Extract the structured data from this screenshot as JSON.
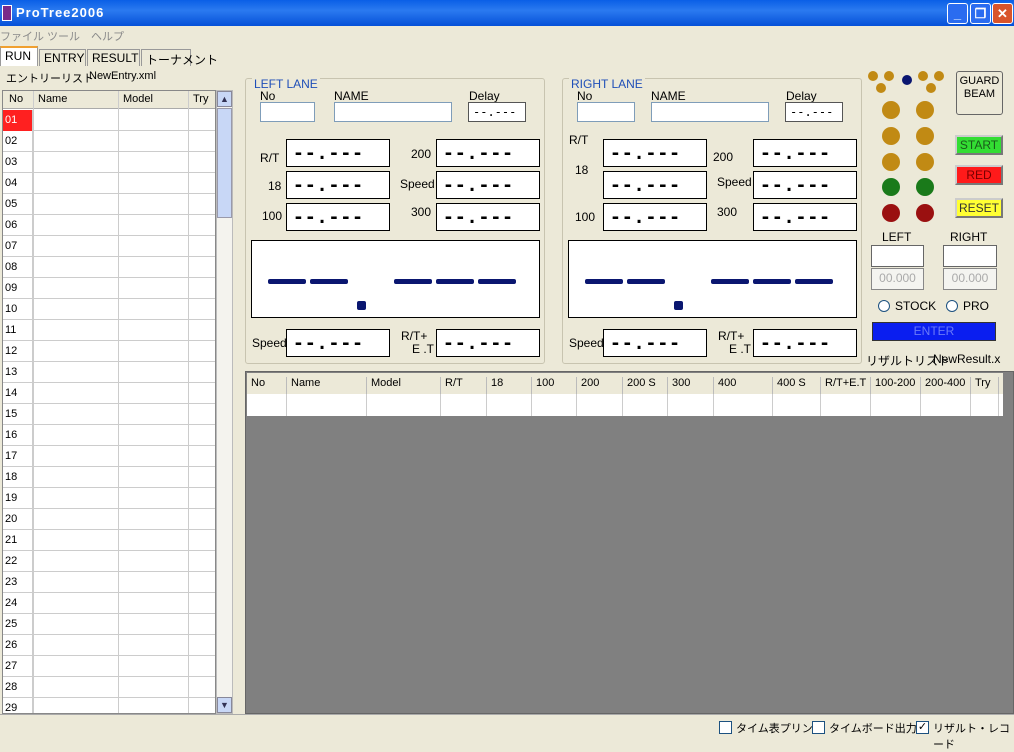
{
  "window": {
    "title": "ProTree2006"
  },
  "menu": [
    "ファイル",
    "ツール",
    "ヘルプ"
  ],
  "tabs": [
    "RUN",
    "ENTRY",
    "RESULT",
    "トーナメント"
  ],
  "entry": {
    "label": "エントリーリスト",
    "file": "NewEntry.xml",
    "headers": [
      "No",
      "Name",
      "Model",
      "Try"
    ],
    "rows": [
      "01",
      "02",
      "03",
      "04",
      "05",
      "06",
      "07",
      "08",
      "09",
      "10",
      "11",
      "12",
      "13",
      "14",
      "15",
      "16",
      "17",
      "18",
      "19",
      "20",
      "21",
      "22",
      "23",
      "24",
      "25",
      "26",
      "27",
      "28",
      "29"
    ]
  },
  "left_lane": {
    "legend": "LEFT LANE",
    "no_label": "No",
    "name_label": "NAME",
    "delay_label": "Delay",
    "delay_value": "--.---",
    "rt_label": "R/T",
    "l18": "18",
    "l100": "100",
    "l200": "200",
    "speed_label": "Speed",
    "l300": "300",
    "rtet_label1": "R/T+",
    "rtet_label2": "E .T"
  },
  "right_lane": {
    "legend": "RIGHT LANE",
    "no_label": "No",
    "name_label": "NAME",
    "delay_label": "Delay",
    "delay_value": "--.---",
    "rt_label": "R/T",
    "l18": "18",
    "l100": "100",
    "l200": "200",
    "speed_label": "Speed",
    "l300": "300",
    "rtet_label1": "R/T+",
    "rtet_label2": "E .T"
  },
  "display_value": "--.---",
  "controls": {
    "guard_beam_1": "GUARD",
    "guard_beam_2": "BEAM",
    "start": "START",
    "red": "RED",
    "reset": "RESET",
    "left": "LEFT",
    "right": "RIGHT",
    "left_digits": "00.000",
    "right_digits": "00.000",
    "stock": "STOCK",
    "pro": "PRO",
    "enter": "ENTER"
  },
  "result": {
    "label": "リザルトリスト",
    "file": "NewResult.x",
    "headers": [
      "No",
      "Name",
      "Model",
      "R/T",
      "18",
      "100",
      "200",
      "200 S",
      "300",
      "400",
      "400 S",
      "R/T+E.T",
      "100-200",
      "200-400",
      "Try"
    ]
  },
  "status": {
    "print": "タイム表プリント",
    "board": "タイムボード出力",
    "record": "リザルト・レコード"
  },
  "colors": {
    "amber": "#c18a14",
    "green": "#1a7a1a",
    "red": "#9a1010",
    "start": "#33dd33",
    "red_btn": "#ff1a1a",
    "reset": "#ffff33",
    "enter": "#0a1ef0"
  }
}
